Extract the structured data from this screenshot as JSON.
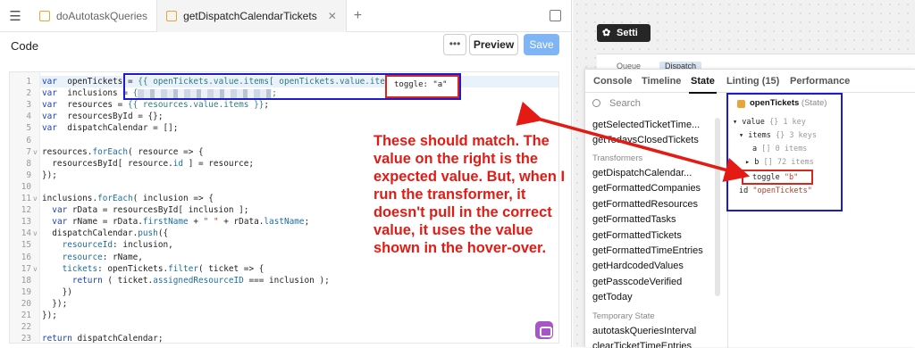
{
  "tabs": [
    {
      "label": "doAutotaskQueries"
    },
    {
      "label": "getDispatchCalendarTickets"
    }
  ],
  "code_bar": {
    "label": "Code",
    "more": "•••",
    "preview": "Preview",
    "save": "Save"
  },
  "editor": {
    "lines": [
      {
        "n": "1",
        "fold": "",
        "segments": [
          [
            "kw",
            "var"
          ],
          [
            "",
            "  openTickets "
          ],
          [
            "",
            "= "
          ],
          [
            "tp",
            "{{ openTickets.value.items[ openTickets.value.items."
          ],
          [
            "",
            ""
          ]
        ]
      },
      {
        "n": "2",
        "fold": "",
        "segments": [
          [
            "kw",
            "var"
          ],
          [
            "",
            "  inclusions "
          ],
          [
            "",
            "= "
          ],
          [
            "tp",
            "{"
          ],
          [
            "blur",
            ""
          ],
          [
            "tp",
            ";"
          ]
        ]
      },
      {
        "n": "3",
        "fold": "",
        "segments": [
          [
            "kw",
            "var"
          ],
          [
            "",
            "  resources "
          ],
          [
            "",
            "= "
          ],
          [
            "tp",
            "{{ resources.value.items }}"
          ],
          [
            "",
            ";"
          ]
        ]
      },
      {
        "n": "4",
        "fold": "",
        "segments": [
          [
            "kw",
            "var"
          ],
          [
            "",
            "  resourcesById = {};"
          ]
        ]
      },
      {
        "n": "5",
        "fold": "",
        "segments": [
          [
            "kw",
            "var"
          ],
          [
            "",
            "  dispatchCalendar = [];"
          ]
        ]
      },
      {
        "n": "6",
        "fold": "",
        "segments": []
      },
      {
        "n": "7",
        "fold": "v",
        "segments": [
          [
            "",
            "resources."
          ],
          [
            "fn",
            "forEach"
          ],
          [
            "",
            "( resource => {"
          ]
        ]
      },
      {
        "n": "8",
        "fold": "",
        "segments": [
          [
            "",
            "  resourcesById[ resource."
          ],
          [
            "fn",
            "id"
          ],
          [
            "",
            " ] = resource;"
          ]
        ]
      },
      {
        "n": "9",
        "fold": "",
        "segments": [
          [
            "",
            "});"
          ]
        ]
      },
      {
        "n": "10",
        "fold": "",
        "segments": []
      },
      {
        "n": "11",
        "fold": "v",
        "segments": [
          [
            "",
            "inclusions."
          ],
          [
            "fn",
            "forEach"
          ],
          [
            "",
            "( inclusion => {"
          ]
        ]
      },
      {
        "n": "12",
        "fold": "",
        "segments": [
          [
            "",
            "  "
          ],
          [
            "kw",
            "var"
          ],
          [
            "",
            " rData = resourcesById[ inclusion ];"
          ]
        ]
      },
      {
        "n": "13",
        "fold": "",
        "segments": [
          [
            "",
            "  "
          ],
          [
            "kw",
            "var"
          ],
          [
            "",
            " rName = rData."
          ],
          [
            "fn",
            "firstName"
          ],
          [
            "",
            " + "
          ],
          [
            "str",
            "\" \""
          ],
          [
            "",
            " + rData."
          ],
          [
            "fn",
            "lastName"
          ],
          [
            "",
            ";"
          ]
        ]
      },
      {
        "n": "14",
        "fold": "v",
        "segments": [
          [
            "",
            "  dispatchCalendar."
          ],
          [
            "fn",
            "push"
          ],
          [
            "",
            "({"
          ]
        ]
      },
      {
        "n": "15",
        "fold": "",
        "segments": [
          [
            "",
            "    "
          ],
          [
            "fn",
            "resourceId"
          ],
          [
            "",
            ": inclusion,"
          ]
        ]
      },
      {
        "n": "16",
        "fold": "",
        "segments": [
          [
            "",
            "    "
          ],
          [
            "fn",
            "resource"
          ],
          [
            "",
            ": rName,"
          ]
        ]
      },
      {
        "n": "17",
        "fold": "v",
        "segments": [
          [
            "",
            "    "
          ],
          [
            "fn",
            "tickets"
          ],
          [
            "",
            ": openTickets."
          ],
          [
            "fn",
            "filter"
          ],
          [
            "",
            "( ticket => {"
          ]
        ]
      },
      {
        "n": "18",
        "fold": "",
        "segments": [
          [
            "",
            "      "
          ],
          [
            "kw",
            "return"
          ],
          [
            "",
            " ( ticket."
          ],
          [
            "fn",
            "assignedResourceID"
          ],
          [
            "",
            " === inclusion );"
          ]
        ]
      },
      {
        "n": "19",
        "fold": "",
        "segments": [
          [
            "",
            "    })"
          ]
        ]
      },
      {
        "n": "20",
        "fold": "",
        "segments": [
          [
            "",
            "  });"
          ]
        ]
      },
      {
        "n": "21",
        "fold": "",
        "segments": [
          [
            "",
            "});"
          ]
        ]
      },
      {
        "n": "22",
        "fold": "",
        "segments": []
      },
      {
        "n": "23",
        "fold": "",
        "segments": [
          [
            "kw",
            "return"
          ],
          [
            "",
            " dispatchCalendar;"
          ]
        ]
      }
    ],
    "tooltip": "toggle: \"a\""
  },
  "annotation": "These should match. The value on the right is the expected value. But, when I run the transformer, it doesn't pull in the correct value, it uses the value shown in the hover-over.",
  "app_preview": {
    "settings_button": "Setti",
    "tab_queue": "Queue",
    "tab_dispatch": "Dispatch"
  },
  "debug": {
    "tabs": [
      "Console",
      "Timeline",
      "State",
      "Linting (15)",
      "Performance"
    ],
    "active_tab": "State",
    "search_placeholder": "Search",
    "items_top": [
      "getSelectedTicketTime...",
      "getTodaysClosedTickets"
    ],
    "section_transformers": "Transformers",
    "transformers": [
      "getDispatchCalendar...",
      "getFormattedCompanies",
      "getFormattedResources",
      "getFormattedTasks",
      "getFormattedTickets",
      "getFormattedTimeEntries",
      "getHardcodedValues",
      "getPasscodeVerified",
      "getToday"
    ],
    "section_temp": "Temporary State",
    "temp_items": [
      "autotaskQueriesInterval",
      "clearTicketTimeEntries"
    ]
  },
  "state": {
    "name": "openTickets",
    "kind": "(State)",
    "tree": {
      "value_key": "value",
      "value_meta": "{} 1 key",
      "items_key": "items",
      "items_meta": "{} 3 keys",
      "a_key": "a",
      "a_meta": "[] 0 items",
      "b_key": "b",
      "b_meta": "[] 72 items",
      "toggle_key": "toggle",
      "toggle_val": "\"b\"",
      "id_key": "id",
      "id_val": "\"openTickets\""
    }
  }
}
